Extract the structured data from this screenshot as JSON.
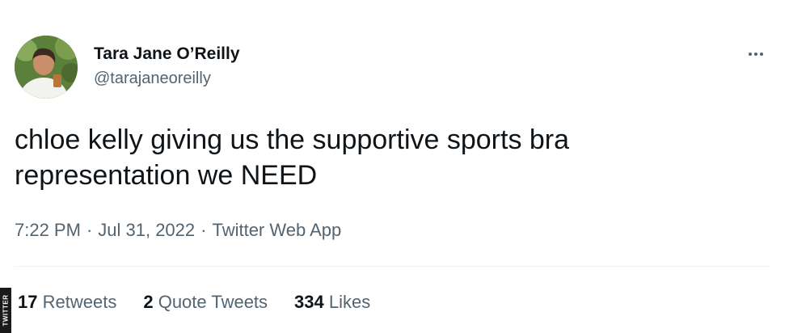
{
  "tweet": {
    "author": {
      "display_name": "Tara Jane O’Reilly",
      "handle": "@tarajaneoreilly"
    },
    "text_line1": "chloe kelly giving us the supportive sports bra",
    "text_line2": "representation we NEED",
    "time": "7:22 PM",
    "separator": "·",
    "date": "Jul 31, 2022",
    "source": "Twitter Web App",
    "stats": {
      "retweets_count": "17",
      "retweets_label": "Retweets",
      "quote_tweets_count": "2",
      "quote_tweets_label": "Quote Tweets",
      "likes_count": "334",
      "likes_label": "Likes"
    }
  },
  "watermark": "TWITTER",
  "icons": {
    "more": "more-horizontal-icon"
  },
  "colors": {
    "text_primary": "#0f1419",
    "text_secondary": "#536471",
    "divider": "#eff3f4"
  }
}
